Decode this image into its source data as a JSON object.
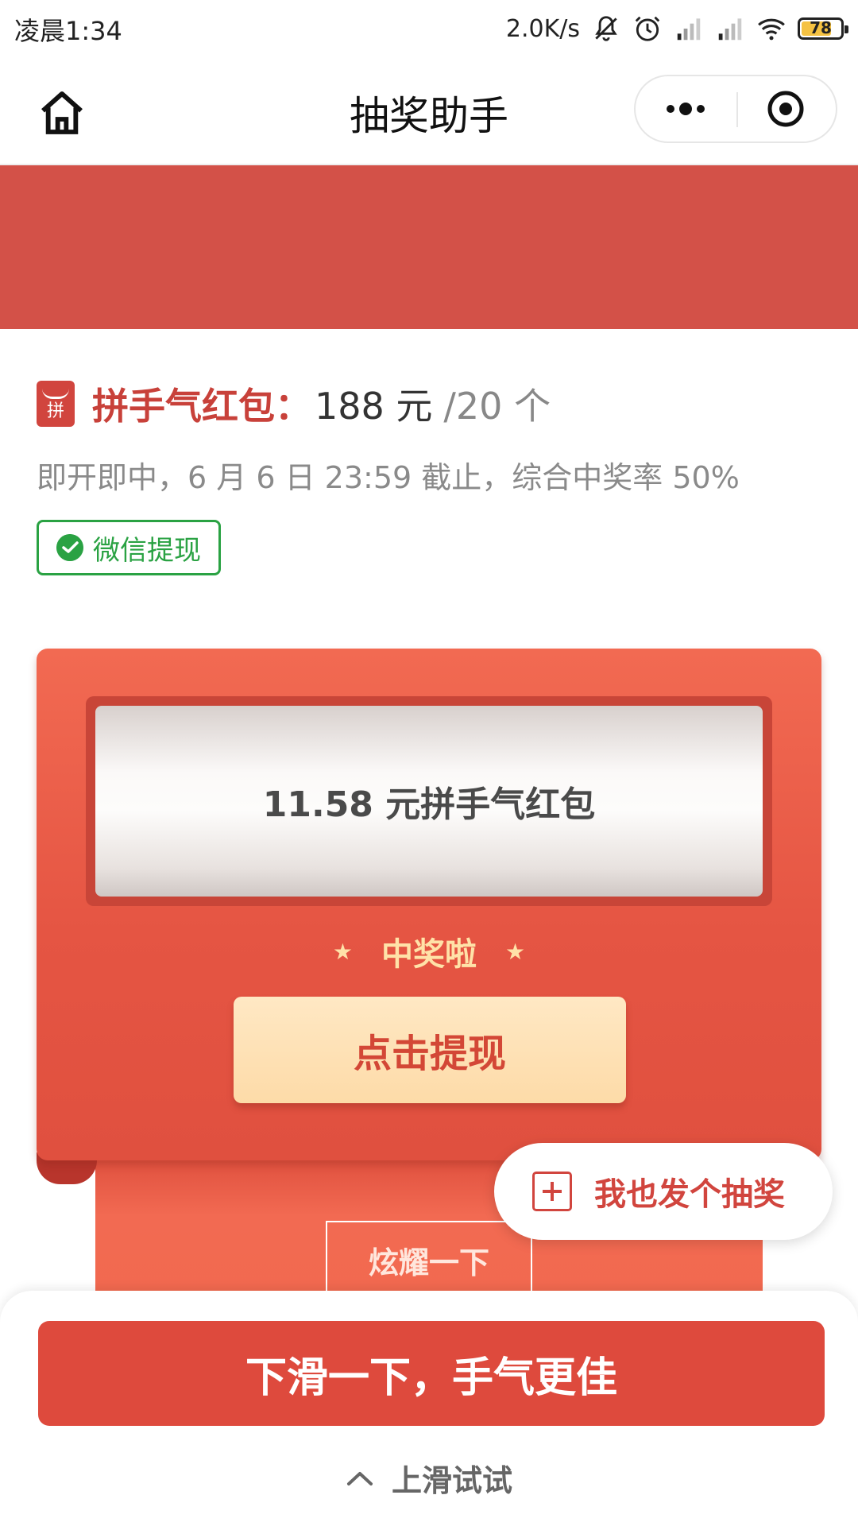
{
  "status_bar": {
    "time": "凌晨1:34",
    "net_speed": "2.0K/s",
    "battery": "78",
    "battery_level": 0.78,
    "icons": [
      "bell-off-icon",
      "alarm-icon",
      "signal-icon",
      "signal-icon",
      "wifi-icon",
      "battery-icon"
    ]
  },
  "nav": {
    "title": "抽奖助手",
    "home_icon": "home-icon",
    "more_icon": "more-icon",
    "close_icon": "target-icon"
  },
  "colors": {
    "brand_red": "#d35148",
    "accent_red": "#de4a3d",
    "wechat_green": "#2aa243",
    "gold": "#ffe2a8"
  },
  "prize": {
    "badge": "拼",
    "type": "拼手气红包：",
    "amount": "188 元",
    "count": "/20 个",
    "description": "即开即中，6 月 6 日 23:59 截止，综合中奖率 50%",
    "tag": "微信提现"
  },
  "card": {
    "result": "11.58 元拼手气红包",
    "star": "★",
    "win_text": "中奖啦",
    "withdraw": "点击提现",
    "show_off": "炫耀一下"
  },
  "fab": {
    "label": "我也发个抽奖"
  },
  "bottom": {
    "main_button": "下滑一下，手气更佳",
    "swipe_hint": "上滑试试"
  }
}
